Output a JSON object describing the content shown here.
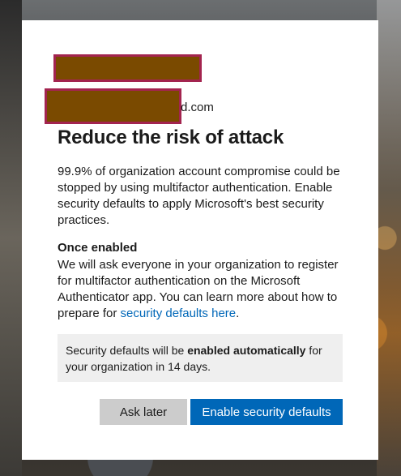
{
  "account": {
    "email_suffix": "d.com"
  },
  "dialog": {
    "title": "Reduce the risk of attack",
    "intro": "99.9% of organization account compromise could be stopped by using multifactor authentication. Enable security defaults to apply Microsoft's best security practices.",
    "once_enabled_heading": "Once enabled",
    "once_enabled_text": "We will ask everyone in your organization to register for multifactor authentication on the Microsoft Authenticator app. You can learn more about how to prepare for ",
    "learn_more_link": "security defaults here",
    "once_enabled_end": ".",
    "notice_prefix": "Security defaults will be ",
    "notice_bold": "enabled automatically",
    "notice_suffix": " for your organization in 14 days."
  },
  "buttons": {
    "ask_later": "Ask later",
    "enable": "Enable security defaults"
  },
  "colors": {
    "primary": "#0067b8",
    "secondary_button": "#cccccc",
    "notice_background": "#efefef"
  }
}
